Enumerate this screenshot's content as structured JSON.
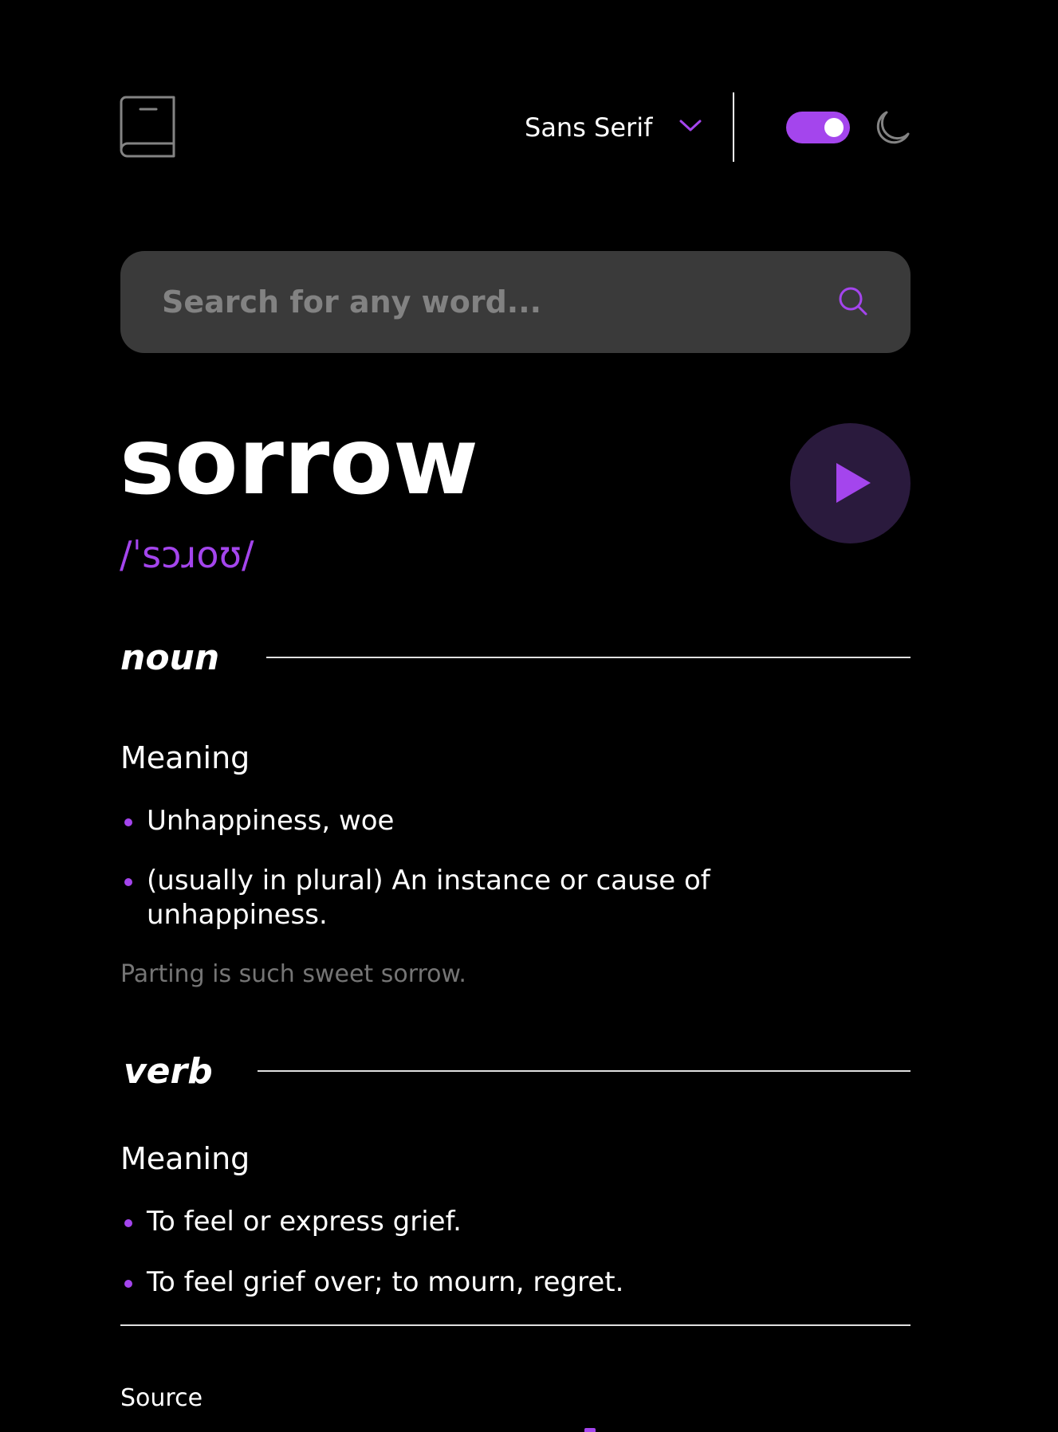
{
  "header": {
    "logo_icon": "book-icon",
    "font_selector": {
      "selected": "Sans Serif",
      "icon": "chevron-down-icon"
    },
    "theme_toggle": {
      "state": "on",
      "icon": "moon-icon"
    }
  },
  "search": {
    "placeholder": "Search for any word...",
    "value": "",
    "icon": "search-icon"
  },
  "entry": {
    "word": "sorrow",
    "phonetic": "/ˈsɔɹoʊ/",
    "play_icon": "play-icon",
    "meanings": [
      {
        "part_of_speech": "noun",
        "heading": "Meaning",
        "definitions": [
          "Unhappiness, woe",
          "(usually in plural) An instance or cause of unhappiness."
        ],
        "example": "Parting is such sweet sorrow."
      },
      {
        "part_of_speech": "verb",
        "heading": "Meaning",
        "definitions": [
          "To feel or express grief.",
          "To feel grief over; to mourn, regret."
        ]
      }
    ]
  },
  "footer": {
    "source_label": "Source"
  },
  "colors": {
    "background": "#000000",
    "accent": "#a445ed",
    "search_bg": "#3a3a3a",
    "muted_text": "#757575",
    "play_bg": "#2a1a3d"
  }
}
